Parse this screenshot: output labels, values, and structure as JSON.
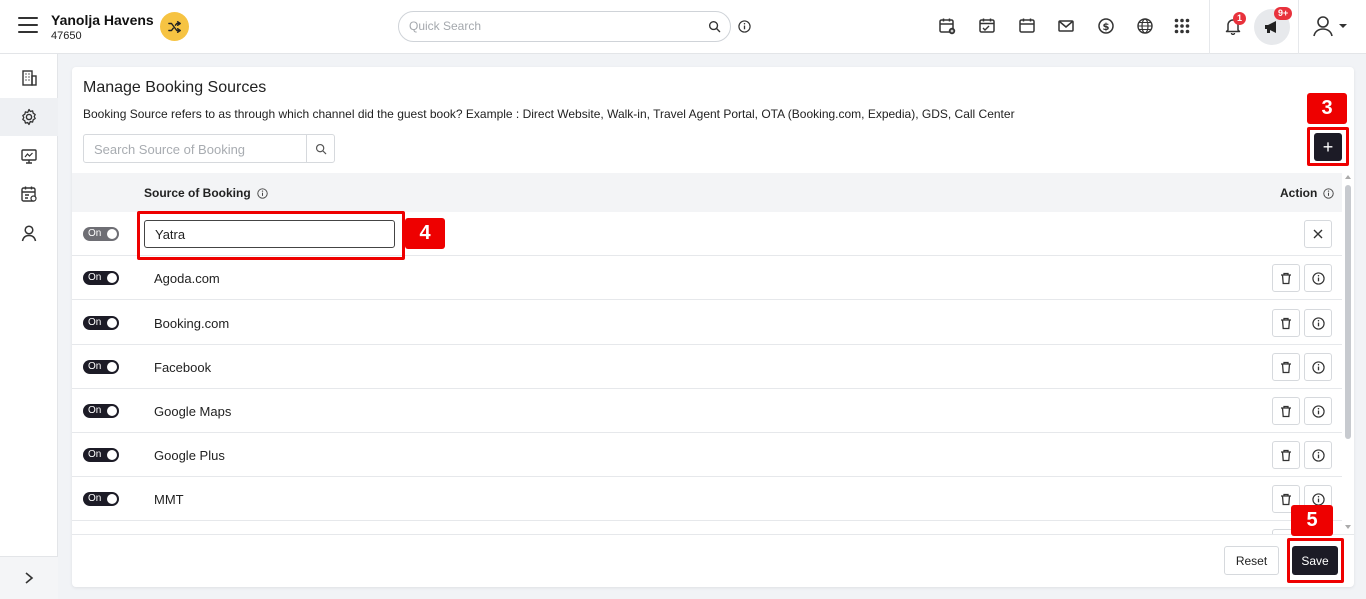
{
  "header": {
    "hotel_name": "Yanolja Havens",
    "hotel_id": "47650",
    "search_placeholder": "Quick Search",
    "notification_count": "1",
    "announcement_count": "9+"
  },
  "page": {
    "title": "Manage Booking Sources",
    "description": "Booking Source refers to as through which channel did the guest book? Example : Direct Website, Walk-in, Travel Agent Portal, OTA (Booking.com, Expedia), GDS, Call Center",
    "search_placeholder": "Search Source of Booking",
    "add_symbol": "+"
  },
  "table": {
    "col_source": "Source of Booking",
    "col_action": "Action",
    "new_row_value": "Yatra",
    "toggle_label": "On",
    "rows": [
      {
        "name": "Agoda.com"
      },
      {
        "name": "Booking.com"
      },
      {
        "name": "Facebook"
      },
      {
        "name": "Google Maps"
      },
      {
        "name": "Google Plus"
      },
      {
        "name": "MMT"
      }
    ]
  },
  "footer": {
    "reset_label": "Reset",
    "save_label": "Save"
  },
  "callouts": {
    "add": "3",
    "input": "4",
    "save": "5"
  },
  "colors": {
    "accent_dark": "#1c1b26",
    "callout_red": "#e00000",
    "switch_yellow": "#f6c342",
    "badge_red": "#e8323c"
  }
}
